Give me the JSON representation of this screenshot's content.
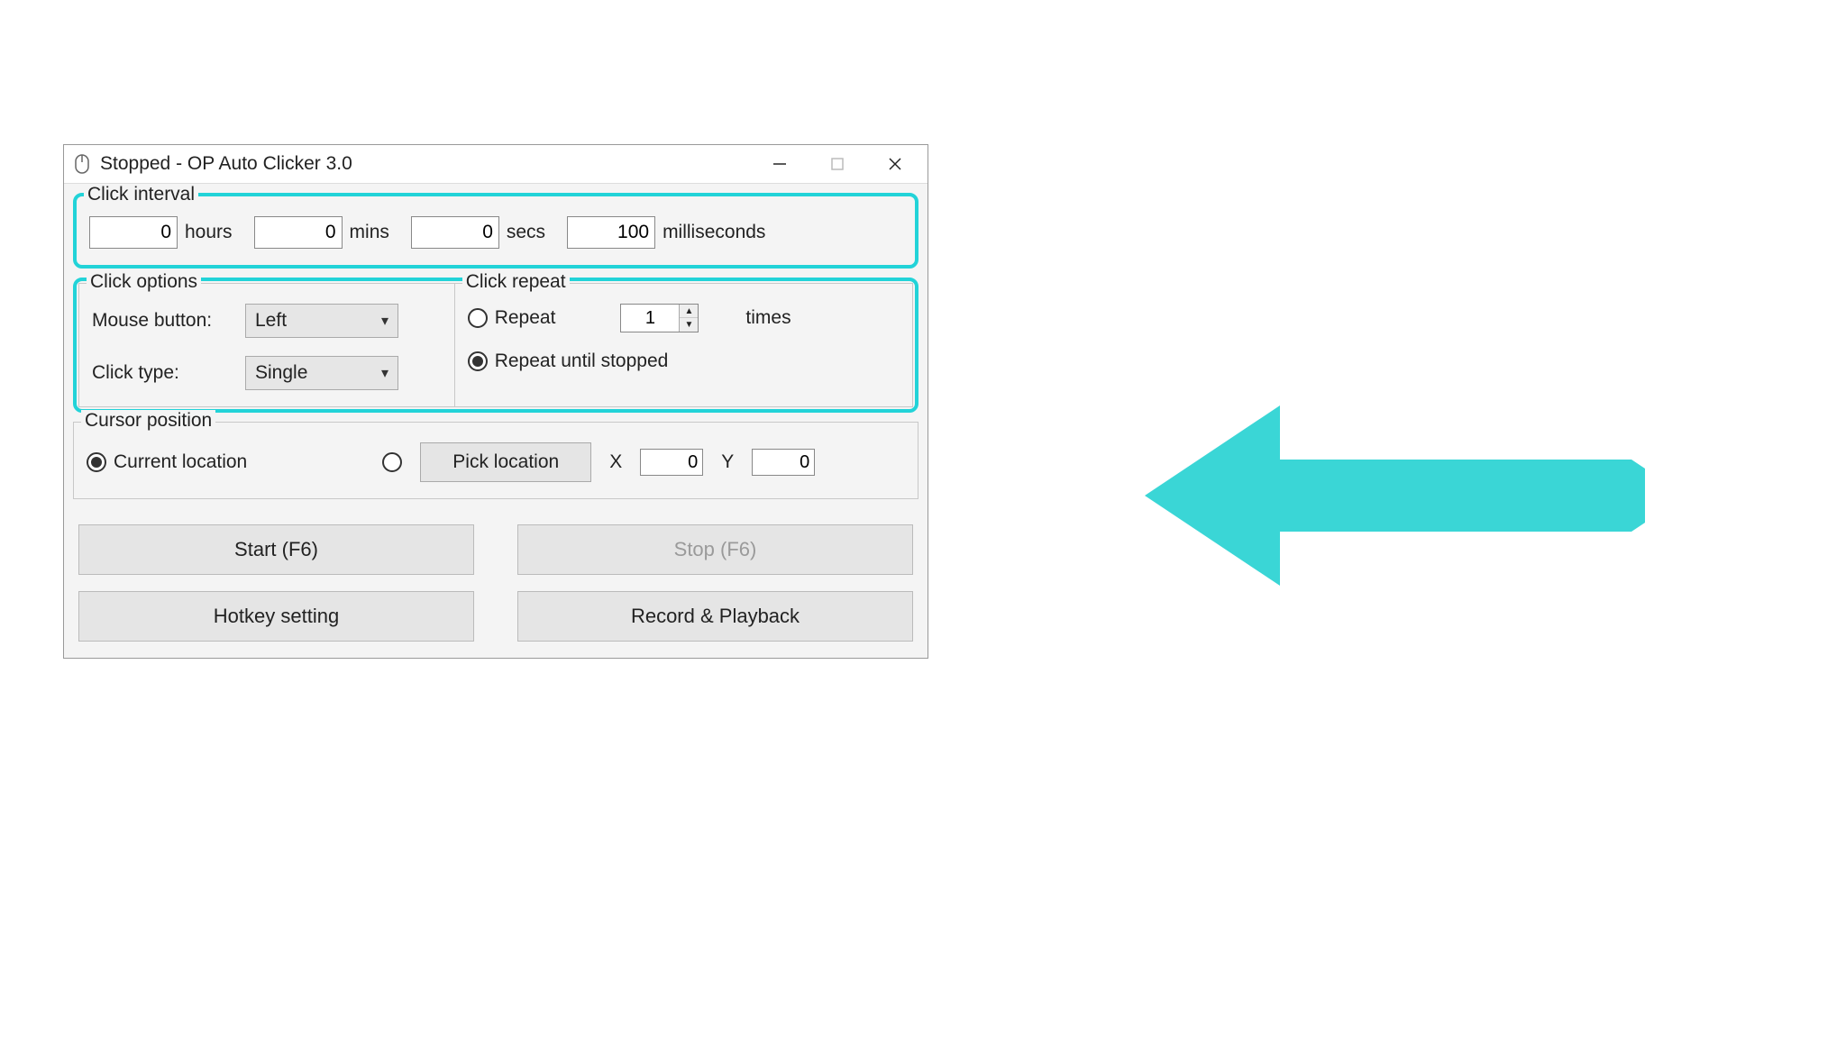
{
  "window": {
    "title": "Stopped - OP Auto Clicker 3.0"
  },
  "interval": {
    "legend": "Click interval",
    "hours": "0",
    "hours_label": "hours",
    "mins": "0",
    "mins_label": "mins",
    "secs": "0",
    "secs_label": "secs",
    "ms": "100",
    "ms_label": "milliseconds"
  },
  "options": {
    "legend": "Click options",
    "mouse_button_label": "Mouse button:",
    "mouse_button_value": "Left",
    "click_type_label": "Click type:",
    "click_type_value": "Single"
  },
  "repeat": {
    "legend": "Click repeat",
    "repeat_label": "Repeat",
    "repeat_count": "1",
    "times_label": "times",
    "until_stopped_label": "Repeat until stopped",
    "mode": "until_stopped"
  },
  "cursor": {
    "legend": "Cursor position",
    "current_label": "Current location",
    "pick_label": "Pick location",
    "mode": "current",
    "x_label": "X",
    "x": "0",
    "y_label": "Y",
    "y": "0"
  },
  "buttons": {
    "start": "Start (F6)",
    "stop": "Stop (F6)",
    "hotkey": "Hotkey setting",
    "record": "Record & Playback"
  },
  "annotation": {
    "arrow_color": "#3ad6d6"
  }
}
